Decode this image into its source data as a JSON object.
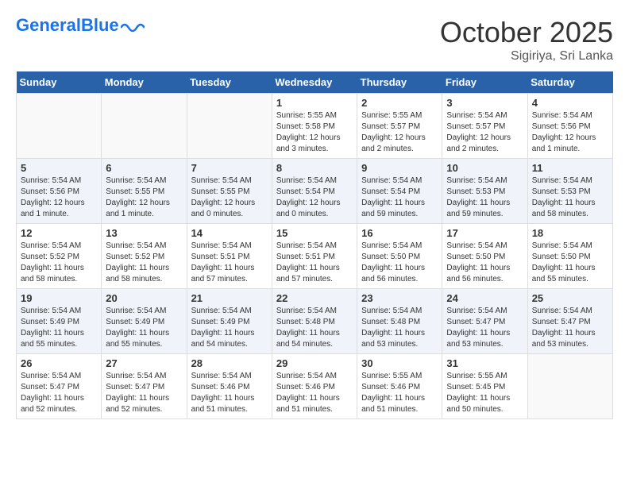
{
  "logo": {
    "general": "General",
    "blue": "Blue"
  },
  "header": {
    "month": "October 2025",
    "location": "Sigiriya, Sri Lanka"
  },
  "weekdays": [
    "Sunday",
    "Monday",
    "Tuesday",
    "Wednesday",
    "Thursday",
    "Friday",
    "Saturday"
  ],
  "weeks": [
    [
      {
        "day": "",
        "info": ""
      },
      {
        "day": "",
        "info": ""
      },
      {
        "day": "",
        "info": ""
      },
      {
        "day": "1",
        "info": "Sunrise: 5:55 AM\nSunset: 5:58 PM\nDaylight: 12 hours\nand 3 minutes."
      },
      {
        "day": "2",
        "info": "Sunrise: 5:55 AM\nSunset: 5:57 PM\nDaylight: 12 hours\nand 2 minutes."
      },
      {
        "day": "3",
        "info": "Sunrise: 5:54 AM\nSunset: 5:57 PM\nDaylight: 12 hours\nand 2 minutes."
      },
      {
        "day": "4",
        "info": "Sunrise: 5:54 AM\nSunset: 5:56 PM\nDaylight: 12 hours\nand 1 minute."
      }
    ],
    [
      {
        "day": "5",
        "info": "Sunrise: 5:54 AM\nSunset: 5:56 PM\nDaylight: 12 hours\nand 1 minute."
      },
      {
        "day": "6",
        "info": "Sunrise: 5:54 AM\nSunset: 5:55 PM\nDaylight: 12 hours\nand 1 minute."
      },
      {
        "day": "7",
        "info": "Sunrise: 5:54 AM\nSunset: 5:55 PM\nDaylight: 12 hours\nand 0 minutes."
      },
      {
        "day": "8",
        "info": "Sunrise: 5:54 AM\nSunset: 5:54 PM\nDaylight: 12 hours\nand 0 minutes."
      },
      {
        "day": "9",
        "info": "Sunrise: 5:54 AM\nSunset: 5:54 PM\nDaylight: 11 hours\nand 59 minutes."
      },
      {
        "day": "10",
        "info": "Sunrise: 5:54 AM\nSunset: 5:53 PM\nDaylight: 11 hours\nand 59 minutes."
      },
      {
        "day": "11",
        "info": "Sunrise: 5:54 AM\nSunset: 5:53 PM\nDaylight: 11 hours\nand 58 minutes."
      }
    ],
    [
      {
        "day": "12",
        "info": "Sunrise: 5:54 AM\nSunset: 5:52 PM\nDaylight: 11 hours\nand 58 minutes."
      },
      {
        "day": "13",
        "info": "Sunrise: 5:54 AM\nSunset: 5:52 PM\nDaylight: 11 hours\nand 58 minutes."
      },
      {
        "day": "14",
        "info": "Sunrise: 5:54 AM\nSunset: 5:51 PM\nDaylight: 11 hours\nand 57 minutes."
      },
      {
        "day": "15",
        "info": "Sunrise: 5:54 AM\nSunset: 5:51 PM\nDaylight: 11 hours\nand 57 minutes."
      },
      {
        "day": "16",
        "info": "Sunrise: 5:54 AM\nSunset: 5:50 PM\nDaylight: 11 hours\nand 56 minutes."
      },
      {
        "day": "17",
        "info": "Sunrise: 5:54 AM\nSunset: 5:50 PM\nDaylight: 11 hours\nand 56 minutes."
      },
      {
        "day": "18",
        "info": "Sunrise: 5:54 AM\nSunset: 5:50 PM\nDaylight: 11 hours\nand 55 minutes."
      }
    ],
    [
      {
        "day": "19",
        "info": "Sunrise: 5:54 AM\nSunset: 5:49 PM\nDaylight: 11 hours\nand 55 minutes."
      },
      {
        "day": "20",
        "info": "Sunrise: 5:54 AM\nSunset: 5:49 PM\nDaylight: 11 hours\nand 55 minutes."
      },
      {
        "day": "21",
        "info": "Sunrise: 5:54 AM\nSunset: 5:49 PM\nDaylight: 11 hours\nand 54 minutes."
      },
      {
        "day": "22",
        "info": "Sunrise: 5:54 AM\nSunset: 5:48 PM\nDaylight: 11 hours\nand 54 minutes."
      },
      {
        "day": "23",
        "info": "Sunrise: 5:54 AM\nSunset: 5:48 PM\nDaylight: 11 hours\nand 53 minutes."
      },
      {
        "day": "24",
        "info": "Sunrise: 5:54 AM\nSunset: 5:47 PM\nDaylight: 11 hours\nand 53 minutes."
      },
      {
        "day": "25",
        "info": "Sunrise: 5:54 AM\nSunset: 5:47 PM\nDaylight: 11 hours\nand 53 minutes."
      }
    ],
    [
      {
        "day": "26",
        "info": "Sunrise: 5:54 AM\nSunset: 5:47 PM\nDaylight: 11 hours\nand 52 minutes."
      },
      {
        "day": "27",
        "info": "Sunrise: 5:54 AM\nSunset: 5:47 PM\nDaylight: 11 hours\nand 52 minutes."
      },
      {
        "day": "28",
        "info": "Sunrise: 5:54 AM\nSunset: 5:46 PM\nDaylight: 11 hours\nand 51 minutes."
      },
      {
        "day": "29",
        "info": "Sunrise: 5:54 AM\nSunset: 5:46 PM\nDaylight: 11 hours\nand 51 minutes."
      },
      {
        "day": "30",
        "info": "Sunrise: 5:55 AM\nSunset: 5:46 PM\nDaylight: 11 hours\nand 51 minutes."
      },
      {
        "day": "31",
        "info": "Sunrise: 5:55 AM\nSunset: 5:45 PM\nDaylight: 11 hours\nand 50 minutes."
      },
      {
        "day": "",
        "info": ""
      }
    ]
  ]
}
